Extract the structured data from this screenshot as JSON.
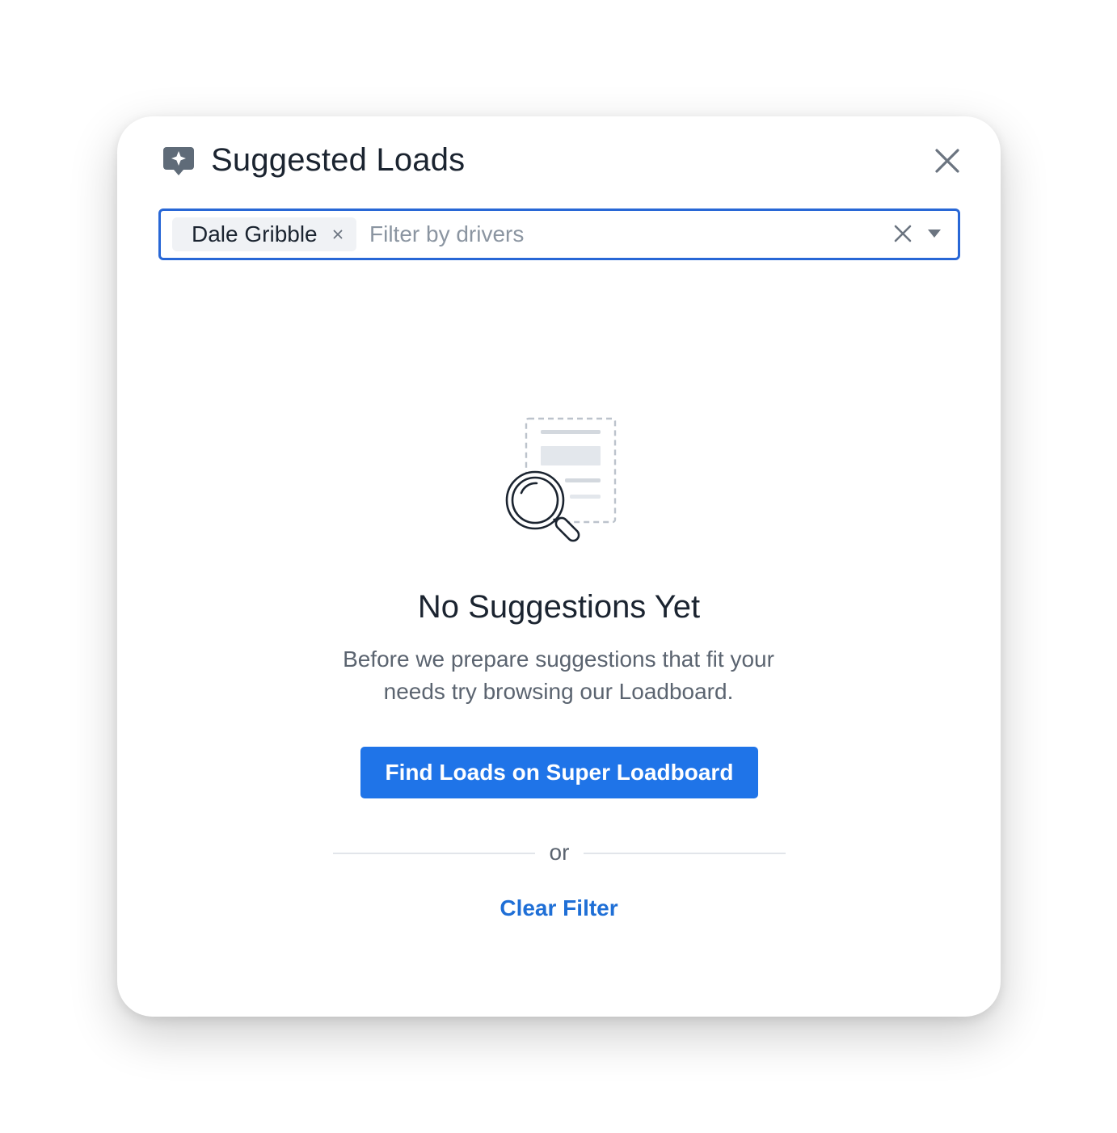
{
  "header": {
    "title": "Suggested Loads",
    "icon": "sparkle-chat-icon",
    "close_icon": "close-icon"
  },
  "filter": {
    "selected_tags": [
      {
        "label": "Dale Gribble",
        "remove_icon": "remove-tag-icon"
      }
    ],
    "placeholder": "Filter by drivers",
    "clear_icon": "clear-icon",
    "dropdown_icon": "caret-down-icon",
    "border_color": "#2867d6"
  },
  "empty_state": {
    "illustration": "document-search-illustration",
    "title": "No Suggestions Yet",
    "description": "Before we prepare suggestions that fit your needs try browsing our Loadboard.",
    "primary_button": "Find Loads on Super Loadboard",
    "divider_text": "or",
    "secondary_link": "Clear Filter"
  },
  "colors": {
    "primary": "#1f74e8",
    "link": "#1f6fd6",
    "text": "#1b2430",
    "muted": "#5b6470"
  }
}
